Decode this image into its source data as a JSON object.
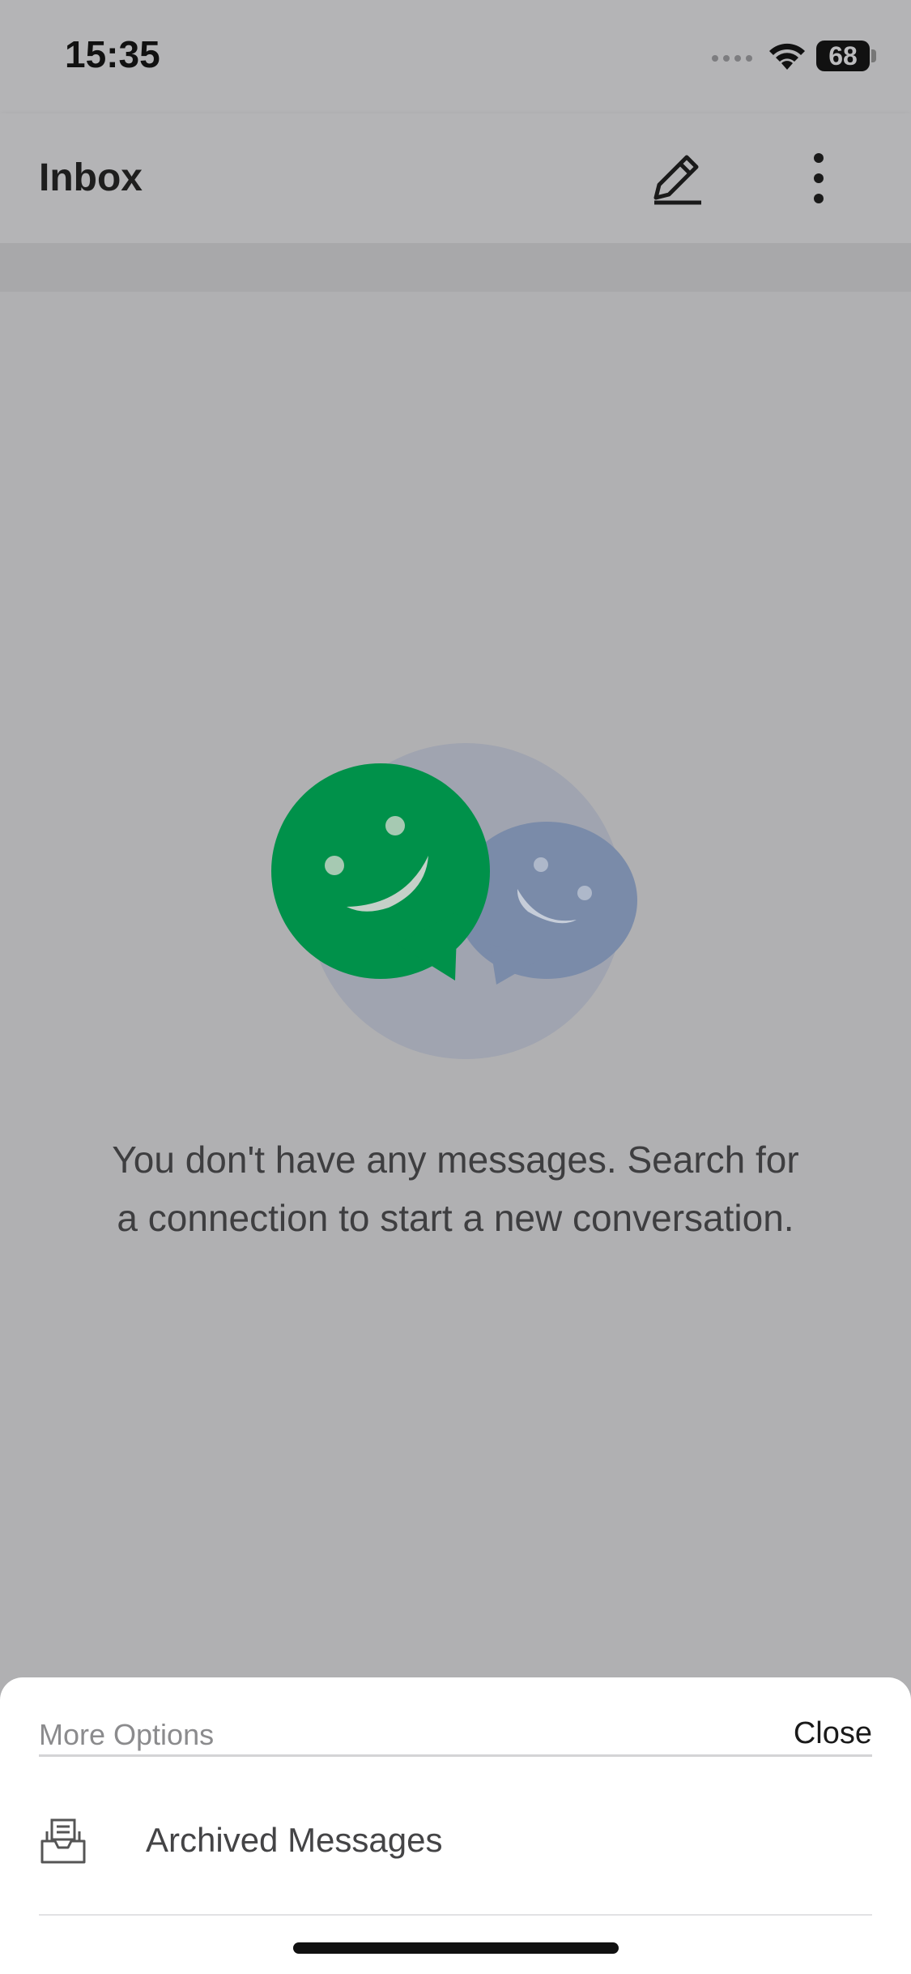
{
  "status_bar": {
    "time": "15:35",
    "battery": "68"
  },
  "app_bar": {
    "title": "Inbox",
    "edit_icon": "edit-icon",
    "more_icon": "more-vertical-icon"
  },
  "empty_state": {
    "illustration": "chat-bubbles-illustration",
    "message": "You don't have any messages. Search for a connection to start a new conversation."
  },
  "sheet": {
    "title": "More Options",
    "close_label": "Close",
    "items": [
      {
        "label": "Archived Messages",
        "icon": "archive-inbox-icon"
      }
    ]
  },
  "colors": {
    "green_bubble": "#00914a",
    "blue_bubble": "#7a8ba9",
    "overlay_background": "#b0b0b2",
    "sheet_background": "#ffffff"
  }
}
